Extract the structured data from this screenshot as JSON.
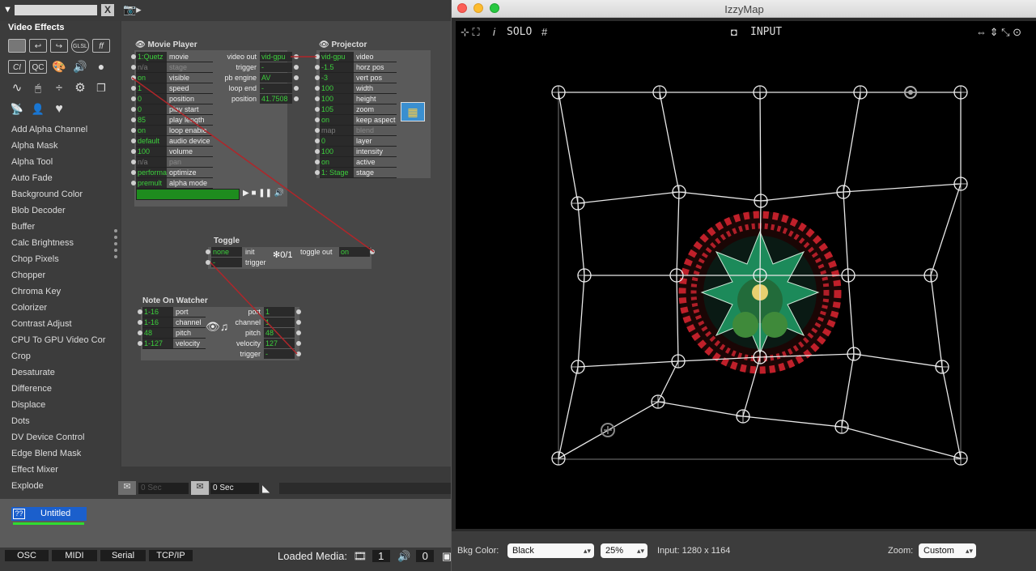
{
  "left": {
    "search_value": "",
    "category_title": "Video Effects",
    "icon_row1": [
      "",
      "",
      "",
      "GLSL",
      "ff"
    ],
    "icon_row2": [
      "CI",
      "QC"
    ],
    "actors": [
      "Add Alpha Channel",
      "Alpha Mask",
      "Alpha Tool",
      "Auto Fade",
      "Background Color",
      "Blob Decoder",
      "Buffer",
      "Calc Brightness",
      "Chop Pixels",
      "Chopper",
      "Chroma Key",
      "Colorizer",
      "Contrast Adjust",
      "CPU To GPU Video Cor",
      "Crop",
      "Desaturate",
      "Difference",
      "Displace",
      "Dots",
      "DV Device Control",
      "Edge Blend Mask",
      "Effect Mixer",
      "Explode"
    ]
  },
  "movie_player": {
    "title": "Movie Player",
    "inputs": [
      {
        "value": "1:Quetz",
        "name": "movie",
        "dim": false
      },
      {
        "value": "n/a",
        "name": "stage",
        "dim": true
      },
      {
        "value": "on",
        "name": "visible",
        "dim": false
      },
      {
        "value": "1",
        "name": "speed",
        "dim": false
      },
      {
        "value": "0",
        "name": "position",
        "dim": false
      },
      {
        "value": "0",
        "name": "play start",
        "dim": false
      },
      {
        "value": "85",
        "name": "play length",
        "dim": false
      },
      {
        "value": "on",
        "name": "loop enable",
        "dim": false
      },
      {
        "value": "default",
        "name": "audio device",
        "dim": false
      },
      {
        "value": "100",
        "name": "volume",
        "dim": false
      },
      {
        "value": "n/a",
        "name": "pan",
        "dim": true
      },
      {
        "value": "performa",
        "name": "optimize",
        "dim": false
      },
      {
        "value": "premult",
        "name": "alpha mode",
        "dim": false
      }
    ],
    "outputs": [
      {
        "name": "video out",
        "value": "vid-gpu"
      },
      {
        "name": "trigger",
        "value": "-"
      },
      {
        "name": "pb engine",
        "value": "AV"
      },
      {
        "name": "loop end",
        "value": "-"
      },
      {
        "name": "position",
        "value": "41.7508"
      }
    ]
  },
  "projector": {
    "title": "Projector",
    "inputs": [
      {
        "value": "vid-gpu",
        "name": "video",
        "dim": false
      },
      {
        "value": "-1.5",
        "name": "horz pos",
        "dim": false
      },
      {
        "value": "-3",
        "name": "vert pos",
        "dim": false
      },
      {
        "value": "100",
        "name": "width",
        "dim": false
      },
      {
        "value": "100",
        "name": "height",
        "dim": false
      },
      {
        "value": "105",
        "name": "zoom",
        "dim": false
      },
      {
        "value": "on",
        "name": "keep aspect",
        "dim": false
      },
      {
        "value": "map",
        "name": "blend",
        "dim": true
      },
      {
        "value": "0",
        "name": "layer",
        "dim": false
      },
      {
        "value": "100",
        "name": "intensity",
        "dim": false
      },
      {
        "value": "on",
        "name": "active",
        "dim": false
      },
      {
        "value": "1: Stage",
        "name": "stage",
        "dim": false
      }
    ]
  },
  "toggle": {
    "title": "Toggle",
    "inputs": [
      {
        "value": "none",
        "name": "init"
      },
      {
        "value": "-",
        "name": "trigger"
      }
    ],
    "glyph": "0/1",
    "output": {
      "name": "toggle out",
      "value": "on"
    }
  },
  "note_watcher": {
    "title": "Note On Watcher",
    "inputs": [
      {
        "value": "1-16",
        "name": "port"
      },
      {
        "value": "1-16",
        "name": "channel"
      },
      {
        "value": "48",
        "name": "pitch"
      },
      {
        "value": "1-127",
        "name": "velocity"
      }
    ],
    "outputs": [
      {
        "name": "port",
        "value": "1"
      },
      {
        "name": "channel",
        "value": "1"
      },
      {
        "name": "pitch",
        "value": "48"
      },
      {
        "name": "velocity",
        "value": "127"
      },
      {
        "name": "trigger",
        "value": "-"
      }
    ]
  },
  "timebar": {
    "field1": "0 Sec",
    "field2": "0 Sec"
  },
  "scene": {
    "tab_label": "Untitled",
    "tab_icon": "??"
  },
  "bottom": {
    "buttons": [
      "OSC",
      "MIDI",
      "Serial",
      "TCP/IP"
    ],
    "loaded_label": "Loaded Media:",
    "video_count": "1",
    "audio_count": "0"
  },
  "izzymap": {
    "window_title": "IzzyMap",
    "tools": {
      "info": "i",
      "solo": "SOLO",
      "grid": "#",
      "input": "INPUT"
    },
    "status": {
      "bkg_label": "Bkg Color:",
      "bkg_value": "Black",
      "opacity_value": "25%",
      "input_info": "Input:  1280 x 1164",
      "zoom_label": "Zoom:",
      "zoom_value": "Custom"
    }
  },
  "colors": {
    "accent_green": "#3cd03c",
    "wire_red": "#b0262a",
    "tab_blue": "#1b5fcc"
  }
}
